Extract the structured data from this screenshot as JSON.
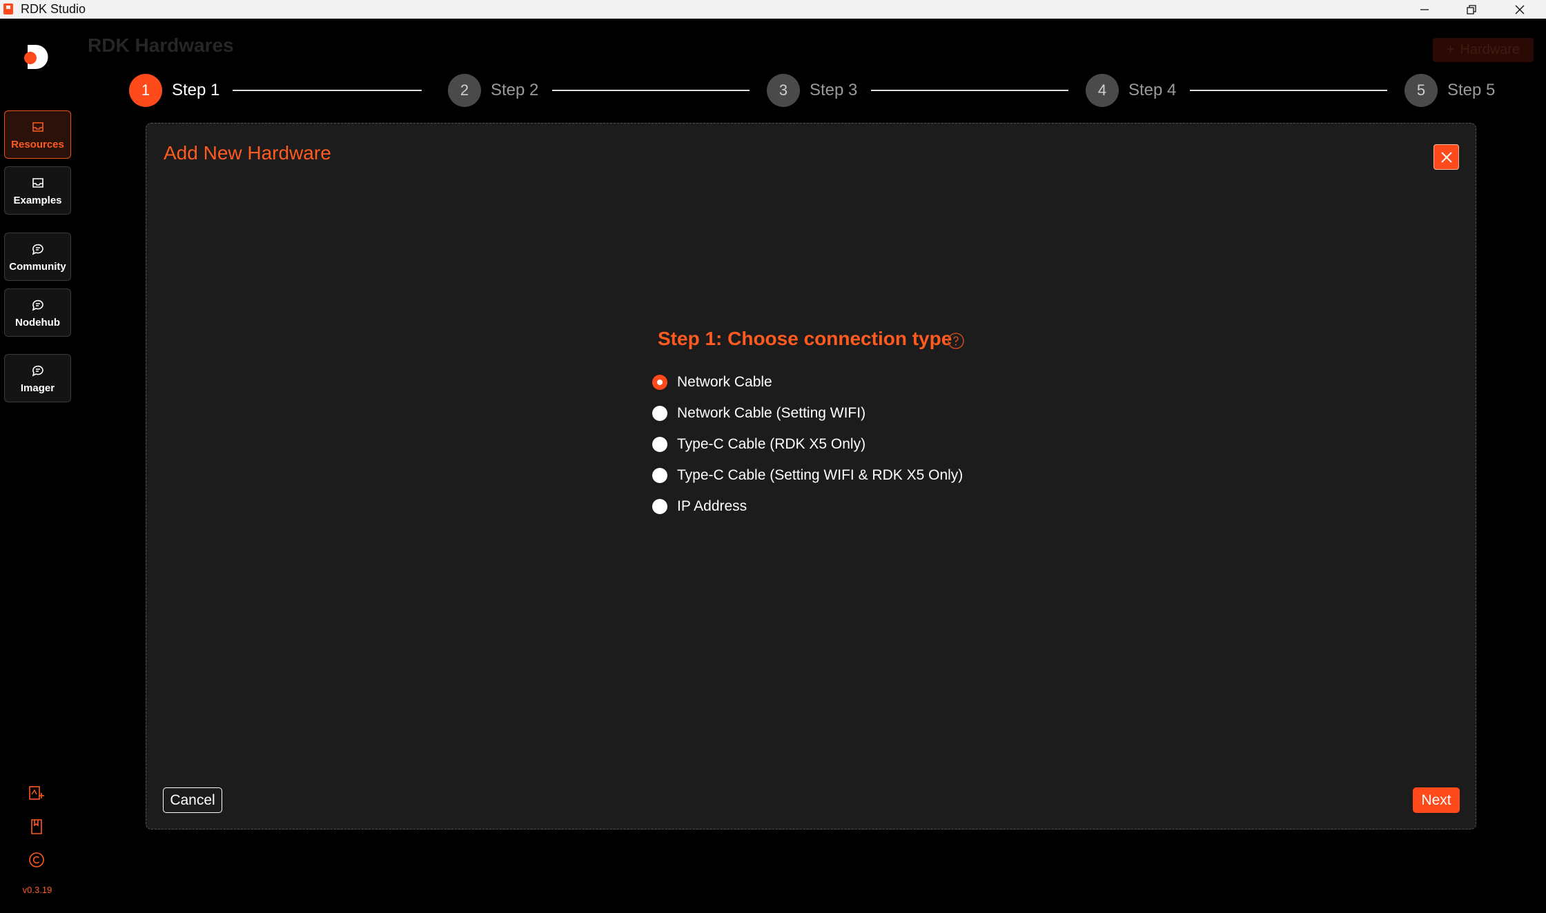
{
  "window": {
    "title": "RDK Studio",
    "minimize_icon": "minimize-icon",
    "restore_icon": "restore-icon",
    "close_icon": "close-icon"
  },
  "sidebar": {
    "items": [
      {
        "label": "Resources",
        "icon": "inbox-icon",
        "active": true
      },
      {
        "label": "Examples",
        "icon": "inbox-icon",
        "active": false
      },
      {
        "label": "Community",
        "icon": "chat-icon",
        "active": false
      },
      {
        "label": "Nodehub",
        "icon": "chat-icon",
        "active": false
      },
      {
        "label": "Imager",
        "icon": "chat-icon",
        "active": false
      }
    ],
    "version": "v0.3.19",
    "accent": "#ff5a1f"
  },
  "background": {
    "page_title": "RDK Hardwares",
    "add_button": "Hardware"
  },
  "steps": [
    {
      "number": "1",
      "label": "Step 1",
      "active": true
    },
    {
      "number": "2",
      "label": "Step 2",
      "active": false
    },
    {
      "number": "3",
      "label": "Step 3",
      "active": false
    },
    {
      "number": "4",
      "label": "Step 4",
      "active": false
    },
    {
      "number": "5",
      "label": "Step 5",
      "active": false
    }
  ],
  "modal": {
    "title": "Add New Hardware",
    "heading": "Step 1: Choose connection type",
    "options": [
      {
        "label": "Network Cable",
        "checked": true
      },
      {
        "label": "Network Cable (Setting WIFI)",
        "checked": false
      },
      {
        "label": "Type-C Cable (RDK X5 Only)",
        "checked": false
      },
      {
        "label": "Type-C Cable (Setting WIFI & RDK X5 Only)",
        "checked": false
      },
      {
        "label": "IP Address",
        "checked": false
      }
    ],
    "cancel_label": "Cancel",
    "next_label": "Next"
  }
}
